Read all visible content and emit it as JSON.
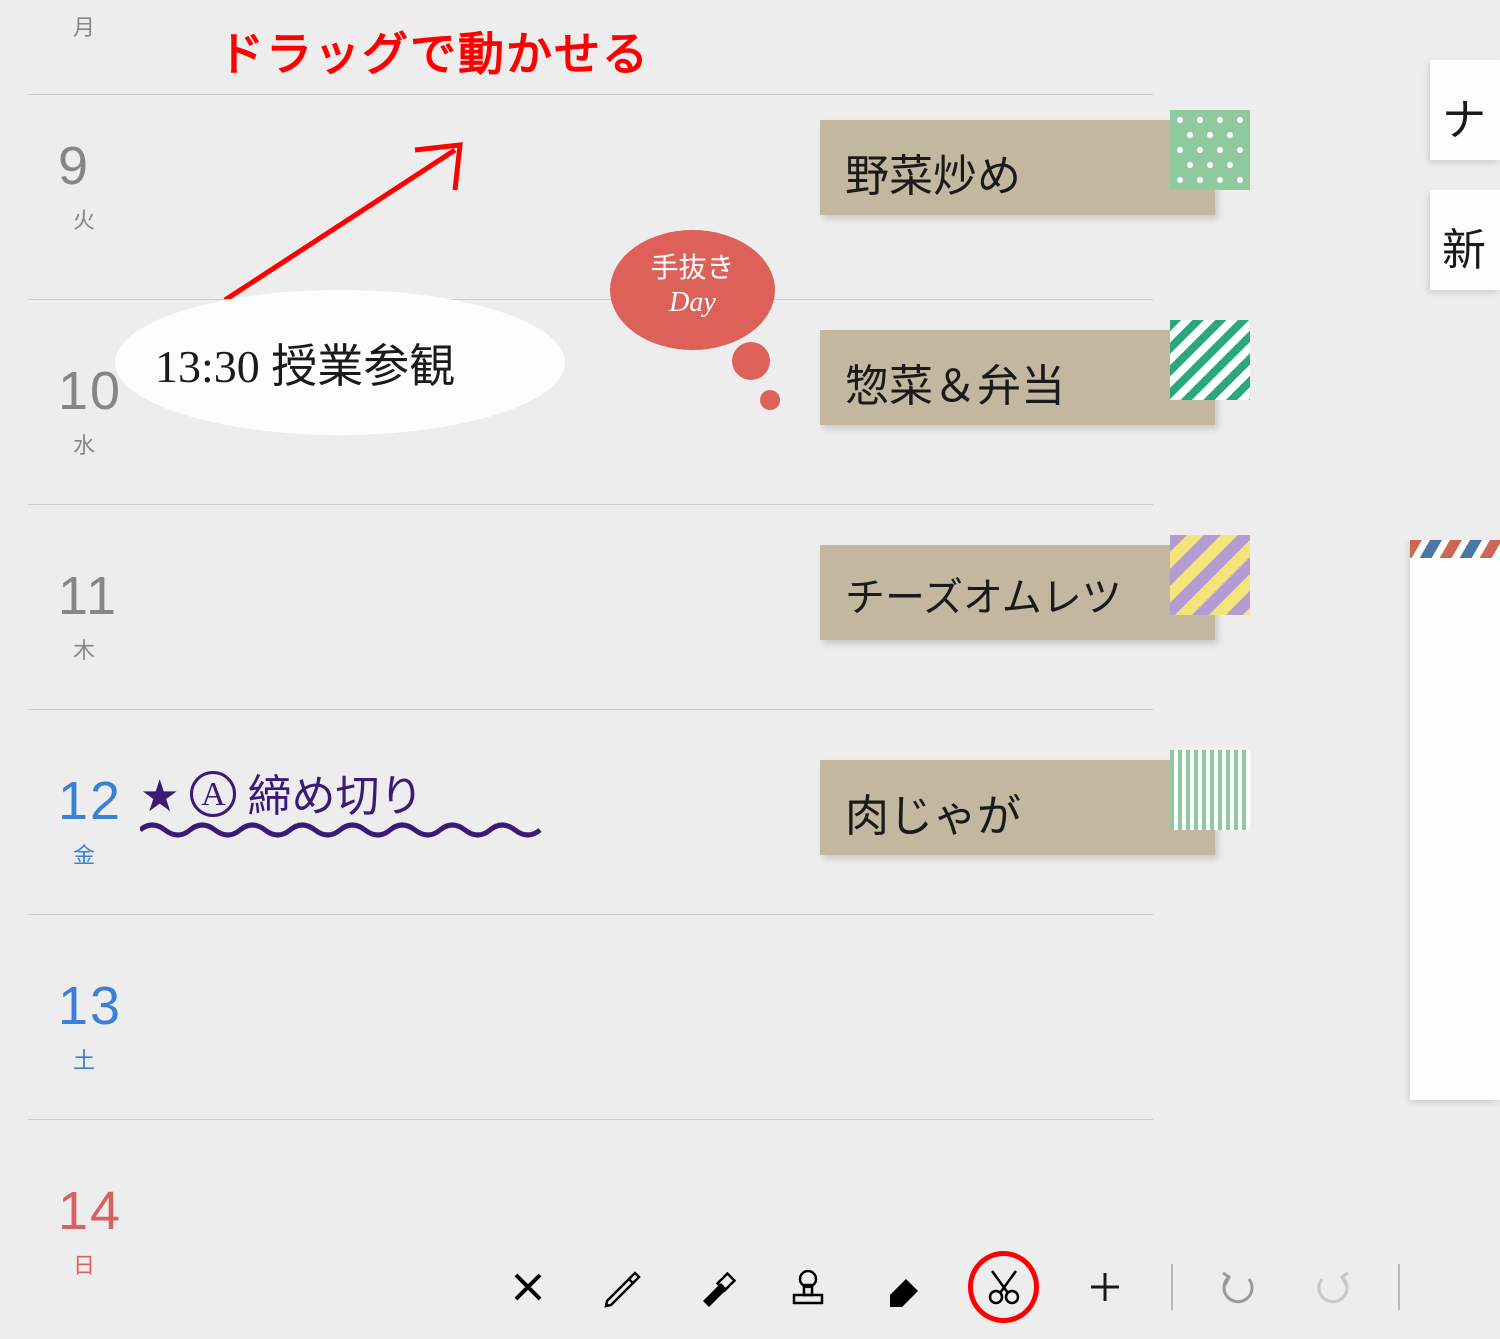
{
  "annotation": {
    "text": "ドラッグで動かせる"
  },
  "days": [
    {
      "num": "",
      "label": "月"
    },
    {
      "num": "9",
      "label": "火"
    },
    {
      "num": "10",
      "label": "水"
    },
    {
      "num": "11",
      "label": "木"
    },
    {
      "num": "12",
      "label": "金"
    },
    {
      "num": "13",
      "label": "土"
    },
    {
      "num": "14",
      "label": "日"
    }
  ],
  "inline_note": "13:30 授業参観",
  "bubble_line1": "手抜き",
  "bubble_line2": "Day",
  "deadline_prefix": "★",
  "deadline_badge": "A",
  "deadline_text": "締め切り",
  "stickies": [
    {
      "text": "野菜炒め"
    },
    {
      "text": "惣菜＆弁当"
    },
    {
      "text": "チーズオムレツ"
    },
    {
      "text": "肉じゃが"
    }
  ],
  "side_stubs": [
    {
      "text": "ナ"
    },
    {
      "text": "新"
    }
  ],
  "toolbar": {
    "close": "close-icon",
    "pen": "pen-icon",
    "marker": "marker-icon",
    "stamp": "stamp-icon",
    "eraser": "eraser-icon",
    "scissors": "scissors-icon",
    "add": "plus-icon",
    "undo": "undo-icon",
    "redo": "redo-icon"
  }
}
